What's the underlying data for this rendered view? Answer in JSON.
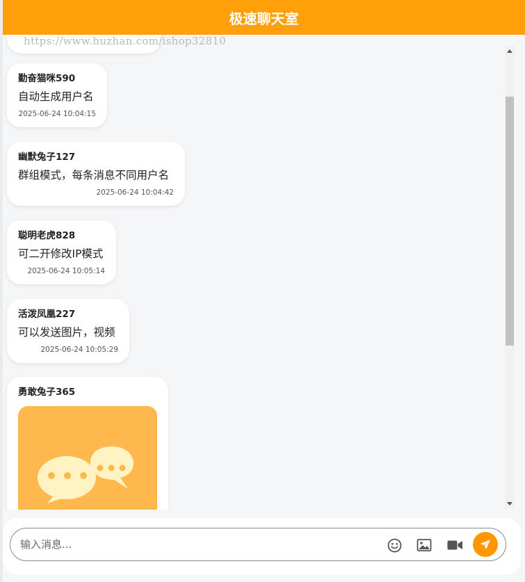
{
  "header": {
    "title": "极速聊天室"
  },
  "watermark": "https://www.huzhan.com/ishop32810",
  "messages": [
    {
      "user": "勤奋猫咪590",
      "text": "自动生成用户名",
      "time": "2025-06-24 10:04:15"
    },
    {
      "user": "幽默兔子127",
      "text": "群组模式，每条消息不同用户名",
      "time": "2025-06-24 10:04:42"
    },
    {
      "user": "聪明老虎828",
      "text": "可二开修改IP模式",
      "time": "2025-06-24 10:05:14"
    },
    {
      "user": "活泼凤凰227",
      "text": "可以发送图片，视频",
      "time": "2025-06-24 10:05:29"
    },
    {
      "user": "勇敢兔子365",
      "media": "chat-bubbles-image"
    }
  ],
  "composer": {
    "placeholder": "输入消息...",
    "icons": [
      "emoji-icon",
      "image-icon",
      "video-icon",
      "send-icon"
    ]
  },
  "colors": {
    "accent": "#ff9f0a",
    "send_button": "#ff9800",
    "media_background": "#ffb84d",
    "media_bubbles": "#fff3c4"
  }
}
